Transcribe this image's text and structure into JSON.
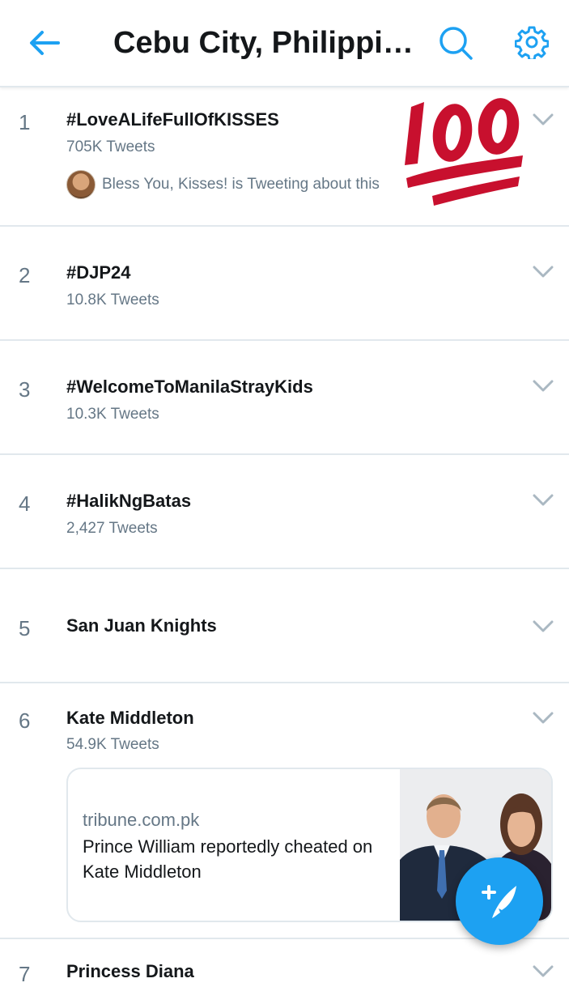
{
  "header": {
    "title": "Cebu City, Philippi…",
    "accent_color": "#1da1f2",
    "icons": [
      "back-arrow-icon",
      "search-icon",
      "gear-icon"
    ]
  },
  "trends": [
    {
      "rank": "1",
      "name": "#LoveALifeFullOfKISSES",
      "count": "705K Tweets",
      "context": "Bless You, Kisses! is Tweeting about this",
      "emoji": "100-emoji"
    },
    {
      "rank": "2",
      "name": "#DJP24",
      "count": "10.8K Tweets"
    },
    {
      "rank": "3",
      "name": "#WelcomeToManilaStrayKids",
      "count": "10.3K Tweets"
    },
    {
      "rank": "4",
      "name": "#HalikNgBatas",
      "count": "2,427 Tweets"
    },
    {
      "rank": "5",
      "name": "San Juan Knights"
    },
    {
      "rank": "6",
      "name": "Kate Middleton",
      "count": "54.9K Tweets",
      "card": {
        "domain": "tribune.com.pk",
        "title": "Prince William reportedly cheated on Kate Middleton"
      }
    },
    {
      "rank": "7",
      "name": "Princess Diana"
    }
  ],
  "fab": {
    "icon": "compose-tweet-icon"
  }
}
